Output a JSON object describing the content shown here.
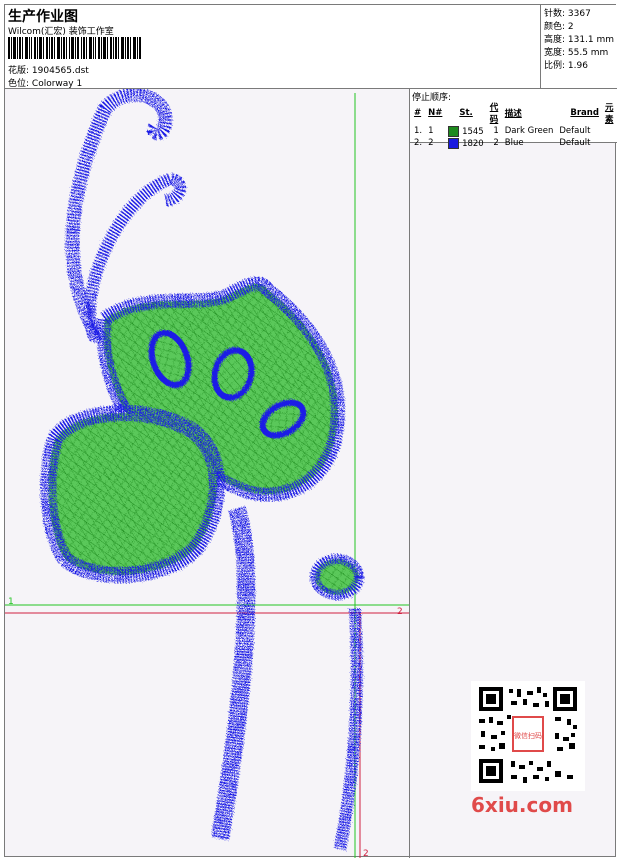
{
  "header": {
    "title": "生产作业图",
    "company": "Wilcom(汇宏) 装饰工作室",
    "design_label": "花版:",
    "design_value": "1904565.dst",
    "colorway_label": "色位:",
    "colorway_value": "Colorway 1"
  },
  "stats": {
    "stitches": "针数: 3367",
    "colors": "颜色: 2",
    "height": "高度: 131.1 mm",
    "width": "宽度: 55.5 mm",
    "scale": "比例: 1.96"
  },
  "stop_sequence": {
    "title": "停止顺序:",
    "columns": [
      "#",
      "N#",
      "St.",
      "代码",
      "描述",
      "Brand",
      "元素"
    ],
    "rows": [
      {
        "idx": "1.",
        "n": "1",
        "stitches": "1545",
        "code": "1",
        "desc": "Dark Green",
        "brand": "Default",
        "color": "#1e8a1e"
      },
      {
        "idx": "2.",
        "n": "2",
        "stitches": "1820",
        "code": "2",
        "desc": "Blue",
        "brand": "Default",
        "color": "#1a1adf"
      }
    ]
  },
  "axes": {
    "label_1": "1",
    "label_2": "2",
    "label_2b": "2"
  },
  "watermark": {
    "text": "6xiu.com",
    "stamp": "微信扫码"
  },
  "colors": {
    "fill_green": "#5ac85a",
    "thread_blue": "#1f1fe6",
    "guide_green": "#22c422",
    "guide_red": "#d02040"
  }
}
